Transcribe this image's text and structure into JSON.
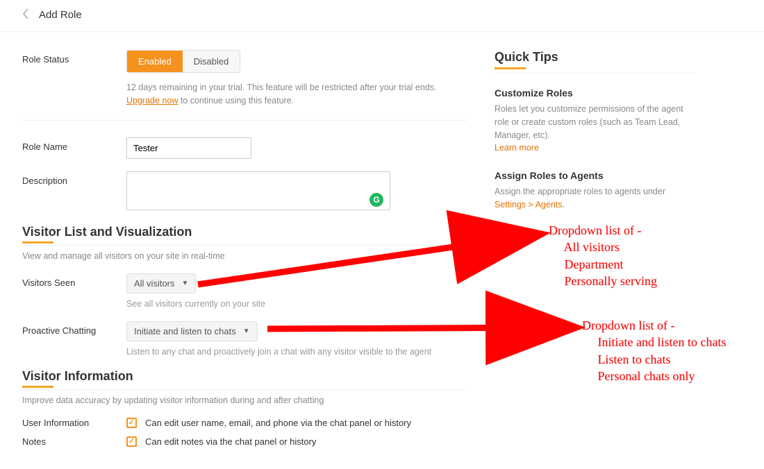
{
  "header": {
    "title": "Add Role"
  },
  "role_status": {
    "label": "Role Status",
    "enabled": "Enabled",
    "disabled": "Disabled",
    "trial_line": "12 days remaining in your trial. This feature will be restricted after your trial ends.",
    "upgrade_link": "Upgrade now",
    "upgrade_tail": " to continue using this feature."
  },
  "role_name": {
    "label": "Role Name",
    "value": "Tester"
  },
  "description": {
    "label": "Description",
    "value": "",
    "grammarly": "G"
  },
  "visitor_list": {
    "heading": "Visitor List and Visualization",
    "sub": "View and manage all visitors on your site in real-time",
    "visitors_seen": {
      "label": "Visitors Seen",
      "selected": "All visitors",
      "hint": "See all visitors currently on your site"
    },
    "proactive": {
      "label": "Proactive Chatting",
      "selected": "Initiate and listen to chats",
      "hint": "Listen to any chat and proactively join a chat with any visitor visible to the agent"
    }
  },
  "visitor_info": {
    "heading": "Visitor Information",
    "sub": "Improve data accuracy by updating visitor information during and after chatting",
    "user_info": {
      "label": "User Information",
      "text": "Can edit user name, email, and phone via the chat panel or history"
    },
    "notes": {
      "label": "Notes",
      "text": "Can edit notes via the chat panel or history"
    }
  },
  "quick_tips": {
    "title": "Quick Tips",
    "customize": {
      "heading": "Customize Roles",
      "body": "Roles let you customize permissions of the agent role or create custom roles (such as Team Lead, Manager, etc).",
      "link": "Learn more"
    },
    "assign": {
      "heading": "Assign Roles to Agents",
      "body_pre": "Assign the appropriate roles to agents under ",
      "link": "Settings > Agents",
      "body_post": "."
    }
  },
  "annotations": {
    "dd1": "Dropdown list of -\n     All visitors\n     Department\n     Personally serving",
    "dd2": "Dropdown list of -\n     Initiate and listen to chats\n     Listen to chats\n     Personal chats only"
  }
}
